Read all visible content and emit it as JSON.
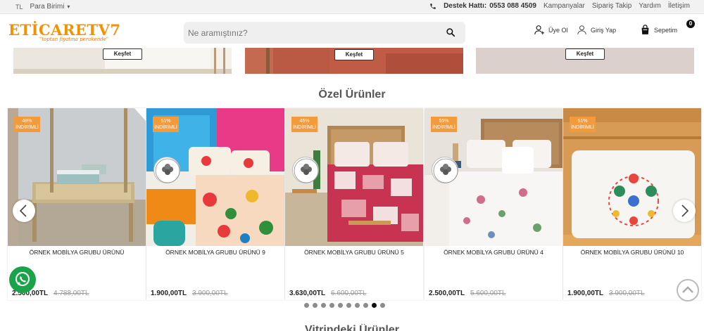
{
  "topbar": {
    "currency_code": "TL",
    "currency_label": "Para Birimi",
    "support_label": "Destek Hattı:",
    "support_phone": "0553 088 4509",
    "links": [
      "Kampanyalar",
      "Sipariş Takip",
      "Yardım",
      "İletişim"
    ]
  },
  "header": {
    "logo_main": "ETİCARETV7",
    "logo_tagline": "\"toptan fiyatına perakende\"",
    "search_placeholder": "Ne aramıştınız?",
    "register_label": "Üye Ol",
    "login_label": "Giriş Yap",
    "cart_label": "Sepetim",
    "cart_count": "0"
  },
  "banners": [
    {
      "button": "Keşfet"
    },
    {
      "button": "Keşfet"
    },
    {
      "button": "Keşfet"
    }
  ],
  "special_section": {
    "title": "Özel Ürünler",
    "products": [
      {
        "discount": "48%",
        "discount_label": "İNDİRİMLİ",
        "name": "ÖRNEK MOBİLYA GRUBU ÜRÜNÜ",
        "price": "2.500,00TL",
        "old_price": "4.788,00TL",
        "cotton_badge": false
      },
      {
        "discount": "51%",
        "discount_label": "İNDİRİMLİ",
        "name": "ÖRNEK MOBİLYA GRUBU ÜRÜNÜ 9",
        "price": "1.900,00TL",
        "old_price": "3.900,00TL",
        "cotton_badge": true
      },
      {
        "discount": "45%",
        "discount_label": "İNDİRİMLİ",
        "name": "ÖRNEK MOBİLYA GRUBU ÜRÜNÜ 5",
        "price": "3.630,00TL",
        "old_price": "6.600,00TL",
        "cotton_badge": true
      },
      {
        "discount": "55%",
        "discount_label": "İNDİRİMLİ",
        "name": "ÖRNEK MOBİLYA GRUBU ÜRÜNÜ 4",
        "price": "2.500,00TL",
        "old_price": "5.600,00TL",
        "cotton_badge": true
      },
      {
        "discount": "51%",
        "discount_label": "İNDİRİMLİ",
        "name": "ÖRNEK MOBİLYA GRUBU ÜRÜNÜ 10",
        "price": "1.900,00TL",
        "old_price": "3.900,00TL",
        "cotton_badge": false
      }
    ],
    "carousel_pages": 10,
    "carousel_active": 8
  },
  "next_section": {
    "title": "Vitrindeki Ürünler"
  },
  "colors": {
    "brand_orange": "#f39200",
    "badge_orange": "#f39a3a",
    "whatsapp_green": "#1aa34a"
  },
  "icons": {
    "whatsapp": "whatsapp-icon",
    "scroll_top": "chevron-up-icon",
    "cotton": "cotton-flower-icon"
  }
}
